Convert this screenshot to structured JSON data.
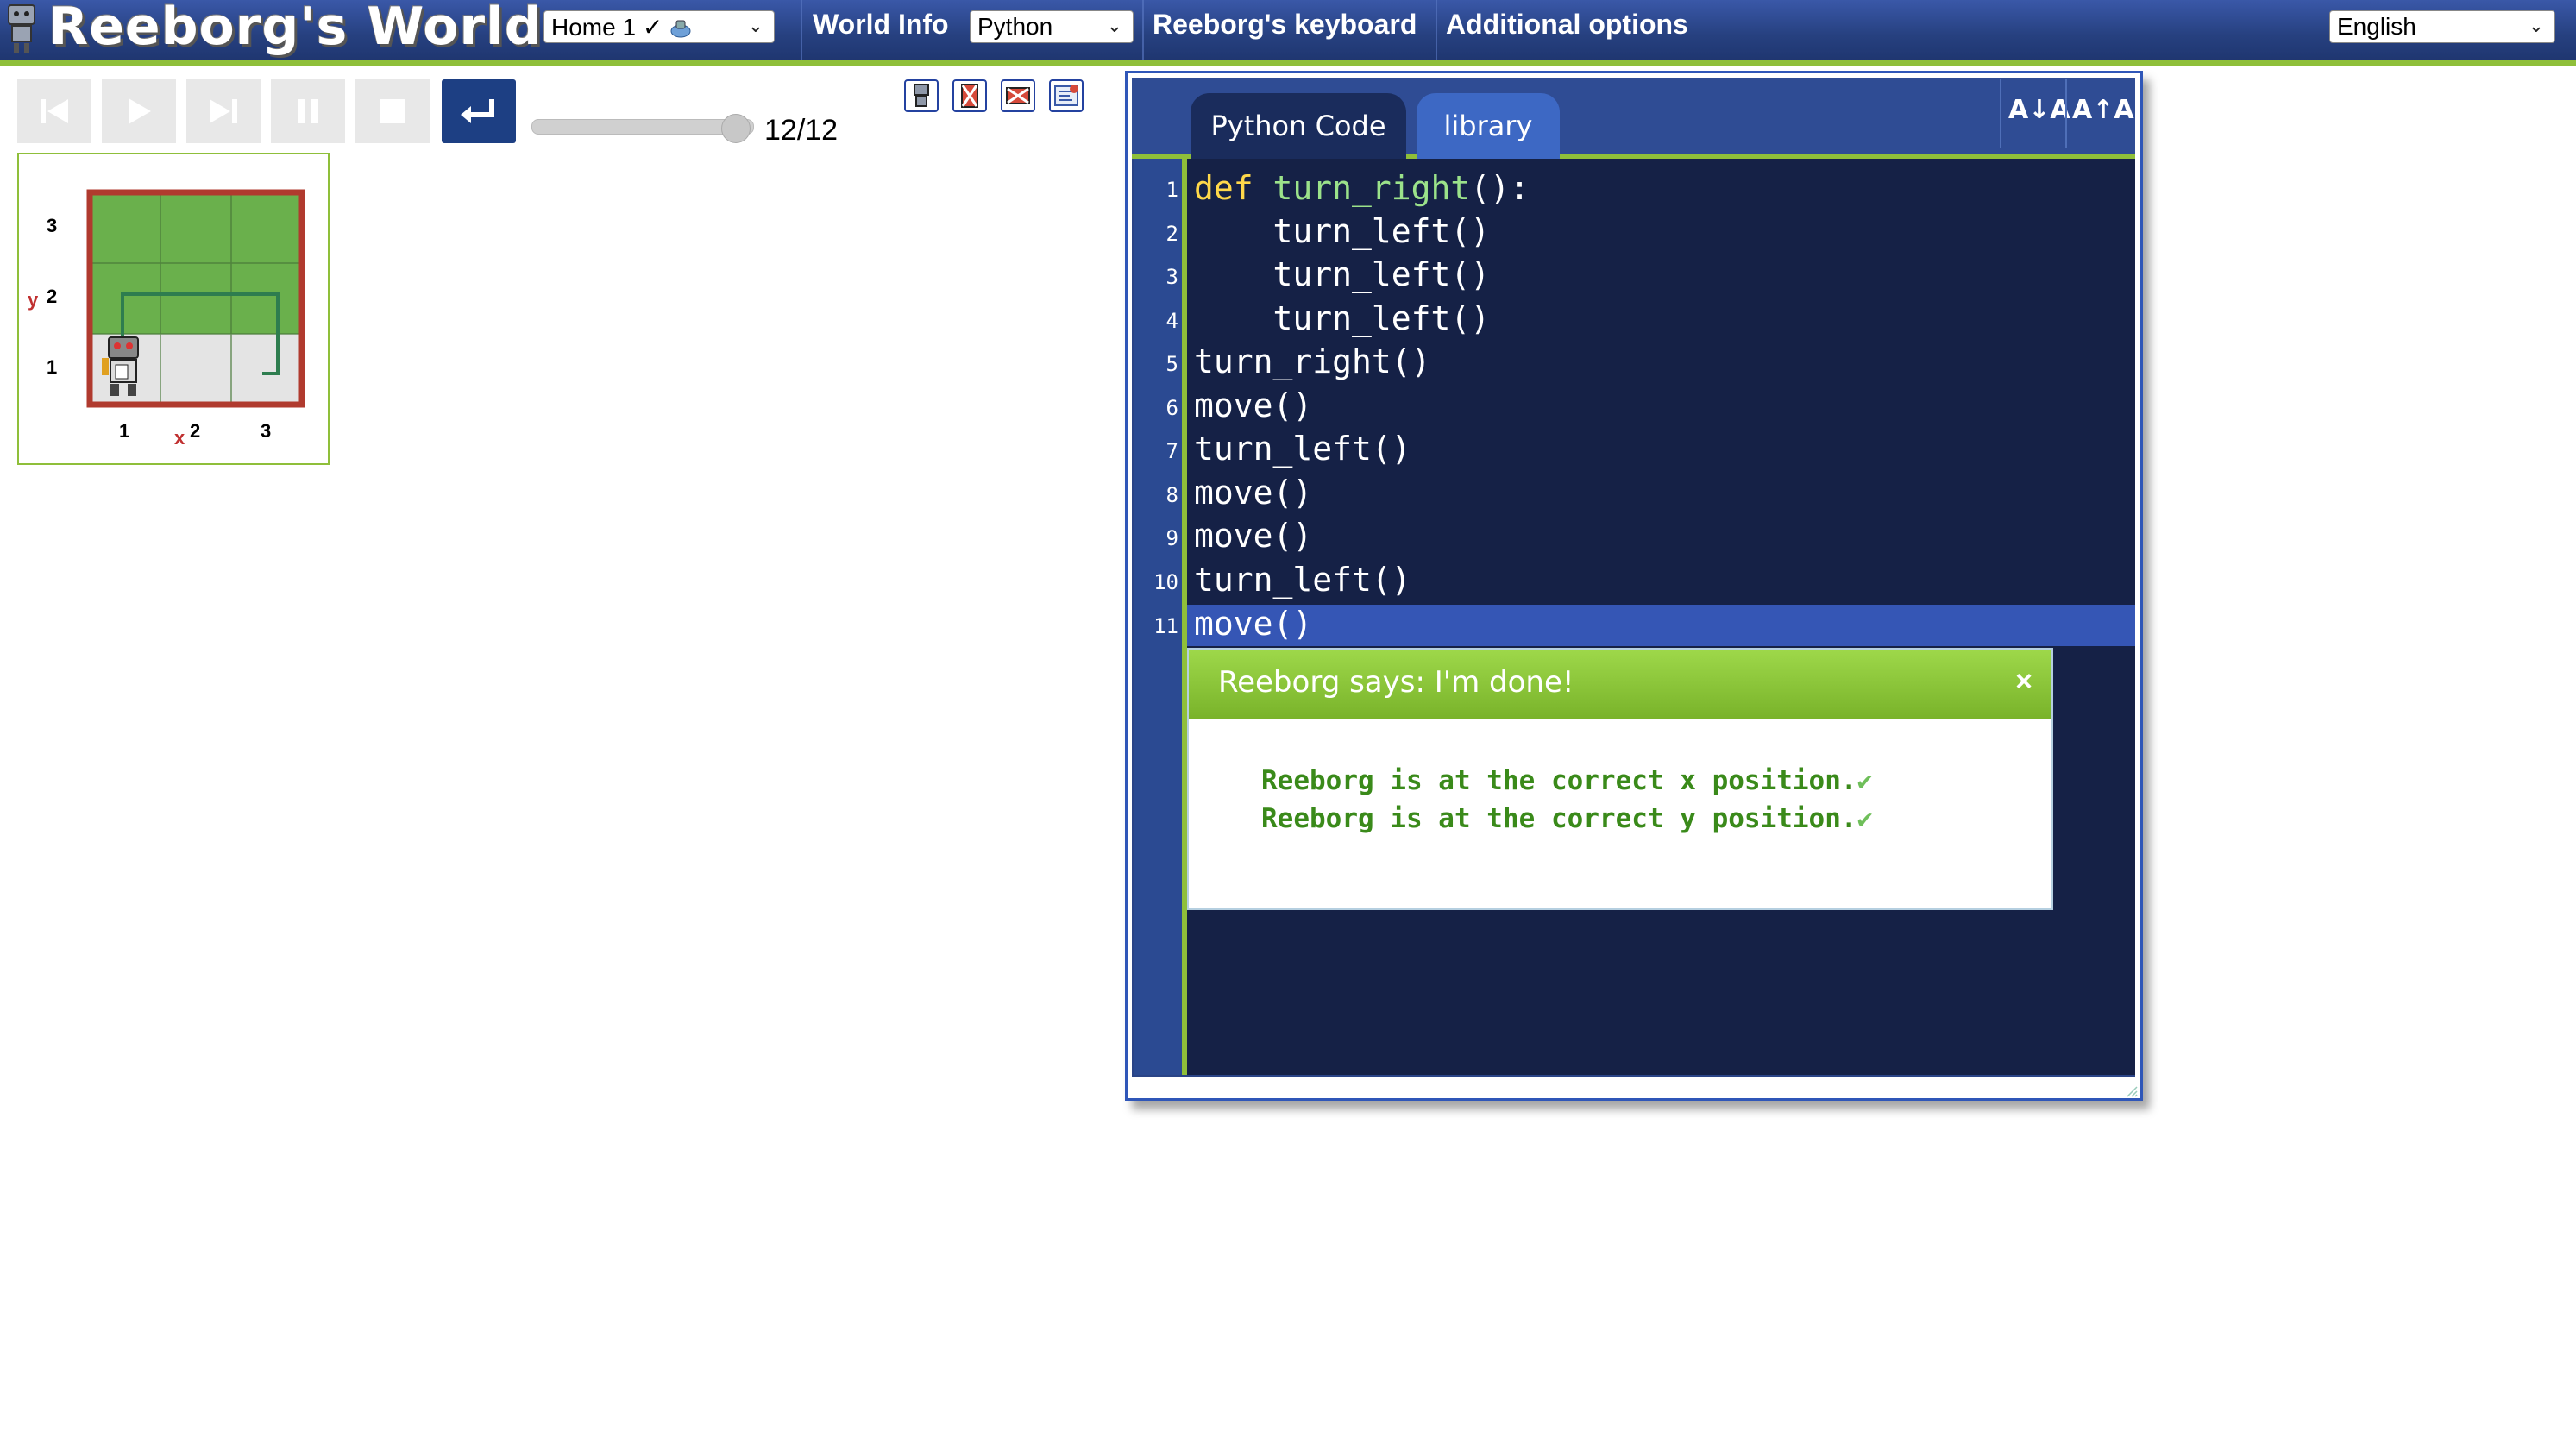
{
  "app": {
    "title": "Reeborg's World"
  },
  "topbar": {
    "world_select": "Home 1 ✓",
    "world_info": "World Info",
    "language_mode": "Python",
    "keyboard": "Reeborg's keyboard",
    "additional_options": "Additional options",
    "ui_language": "English"
  },
  "controls": {
    "step_counter": "12/12",
    "speed_slider_fraction": 1.0,
    "buttons": [
      "reload-icon",
      "run-icon",
      "step-icon",
      "pause-icon",
      "stop-icon",
      "return-icon"
    ]
  },
  "tools": [
    "robot-icon",
    "highlight-icon",
    "watch-icon",
    "editor-icon"
  ],
  "world": {
    "y_axis_name": "y",
    "x_axis_name": "x",
    "y_ticks": [
      "3",
      "2",
      "1"
    ],
    "x_ticks": [
      "1",
      "2",
      "3"
    ],
    "colors": {
      "grass": "#6ab04c",
      "tile": "#e6e6e6",
      "wall": "#b03a2e",
      "path": "#2e7d4f"
    }
  },
  "editor": {
    "tabs": [
      "Python Code",
      "library"
    ],
    "font_decrease": "A↓A",
    "font_increase": "A↑A",
    "lines": [
      {
        "n": "1",
        "a": "def",
        "b": " turn_right",
        "c": "():"
      },
      {
        "n": "2",
        "a": "",
        "b": "",
        "c": "    turn_left()"
      },
      {
        "n": "3",
        "a": "",
        "b": "",
        "c": "    turn_left()"
      },
      {
        "n": "4",
        "a": "",
        "b": "",
        "c": "    turn_left()"
      },
      {
        "n": "5",
        "a": "",
        "b": "",
        "c": "turn_right()"
      },
      {
        "n": "6",
        "a": "",
        "b": "",
        "c": "move()"
      },
      {
        "n": "7",
        "a": "",
        "b": "",
        "c": "turn_left()"
      },
      {
        "n": "8",
        "a": "",
        "b": "",
        "c": "move()"
      },
      {
        "n": "9",
        "a": "",
        "b": "",
        "c": "move()"
      },
      {
        "n": "10",
        "a": "",
        "b": "",
        "c": "turn_left()"
      },
      {
        "n": "11",
        "a": "",
        "b": "",
        "c": "move()"
      }
    ]
  },
  "dialog": {
    "title": "Reeborg says: I'm done!",
    "close": "×",
    "messages": [
      "Reeborg is at the correct x position.",
      "Reeborg is at the correct y position."
    ],
    "check": "✔"
  }
}
